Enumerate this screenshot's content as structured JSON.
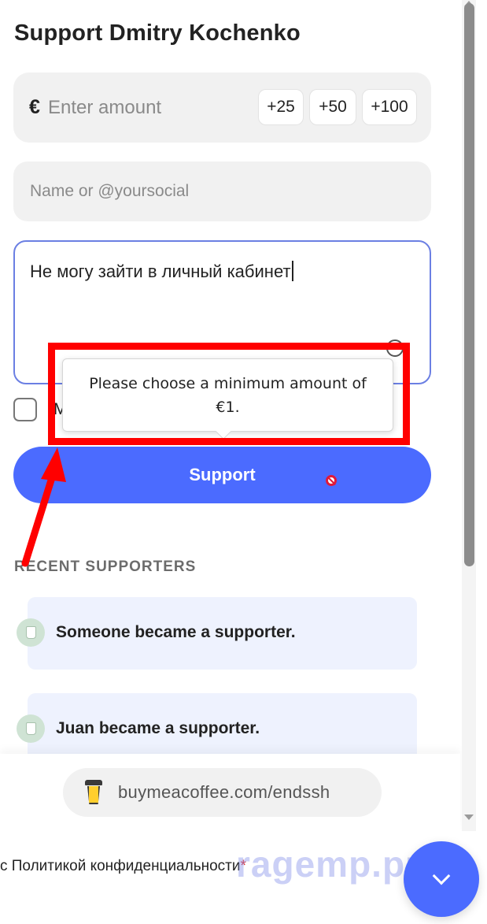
{
  "form": {
    "title": "Support Dmitry Kochenko",
    "currency_symbol": "€",
    "amount_placeholder": "Enter amount",
    "quick_amounts": [
      "+25",
      "+50",
      "+100"
    ],
    "name_placeholder": "Name or @yoursocial",
    "message_value": "Не могу зайти в личный кабинет",
    "checkbox_label_partial": "M",
    "support_label": "Support"
  },
  "tooltip": {
    "text": "Please choose a minimum amount of €1."
  },
  "recent": {
    "heading": "RECENT SUPPORTERS",
    "items": [
      {
        "text": "Someone became a supporter."
      },
      {
        "text": "Juan became a supporter."
      }
    ]
  },
  "footer": {
    "url": "buymeacoffee.com/endssh"
  },
  "page_below": {
    "policy_text": "с Политикой конфиденциальности",
    "required_mark": "*",
    "watermark": "ragemp.pro"
  },
  "colors": {
    "accent": "#4b6bff",
    "annotation": "#ff0000",
    "input_bg": "#f1f1f1",
    "focus_border": "#6b7fe3"
  },
  "icons": {
    "cup": "coffee-cup-icon",
    "not_allowed": "not-allowed-cursor-icon",
    "fab": "chevron-down-icon"
  }
}
